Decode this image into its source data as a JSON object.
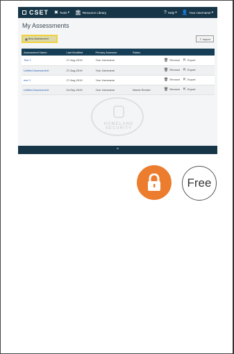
{
  "app": {
    "logo_text": "CSET",
    "nav": {
      "tools_label": "Tools",
      "resource_library_label": "Resource Library",
      "help_label": "Help",
      "user_label": "Your Username"
    },
    "page_title": "My Assessments",
    "new_assessment_label": "New Assessment",
    "import_label": "Import",
    "table": {
      "headers": [
        "Assessment Name",
        "Last Modified",
        "Primary Assessor",
        "Status",
        ""
      ],
      "rows": [
        {
          "name": "Test 1",
          "modified": "27-Aug-2019",
          "assessor": "Your Username",
          "status": "",
          "remove": "Remove",
          "export": "Export"
        },
        {
          "name": "Untitled Assessment",
          "modified": "27-Aug-2019",
          "assessor": "Your Username",
          "status": "",
          "remove": "Remove",
          "export": "Export"
        },
        {
          "name": "test 3",
          "modified": "27-Aug-2019",
          "assessor": "Your Username",
          "status": "",
          "remove": "Remove",
          "export": "Export"
        },
        {
          "name": "Untitled Assessment",
          "modified": "04-Sep-2019",
          "assessor": "Your Username",
          "status": "Needs Review",
          "remove": "Remove",
          "export": "Export"
        }
      ]
    },
    "seal_text": "HOMELAND SECURITY",
    "bottom_chevron": "^"
  },
  "badges": {
    "lock_icon": "lock-icon",
    "free_label": "Free"
  },
  "colors": {
    "nav_bg": "#163648",
    "table_header_bg": "#163e56",
    "highlight_border": "#f1d23a",
    "link": "#2f63b8",
    "lock_bg": "#ec7c2e"
  }
}
